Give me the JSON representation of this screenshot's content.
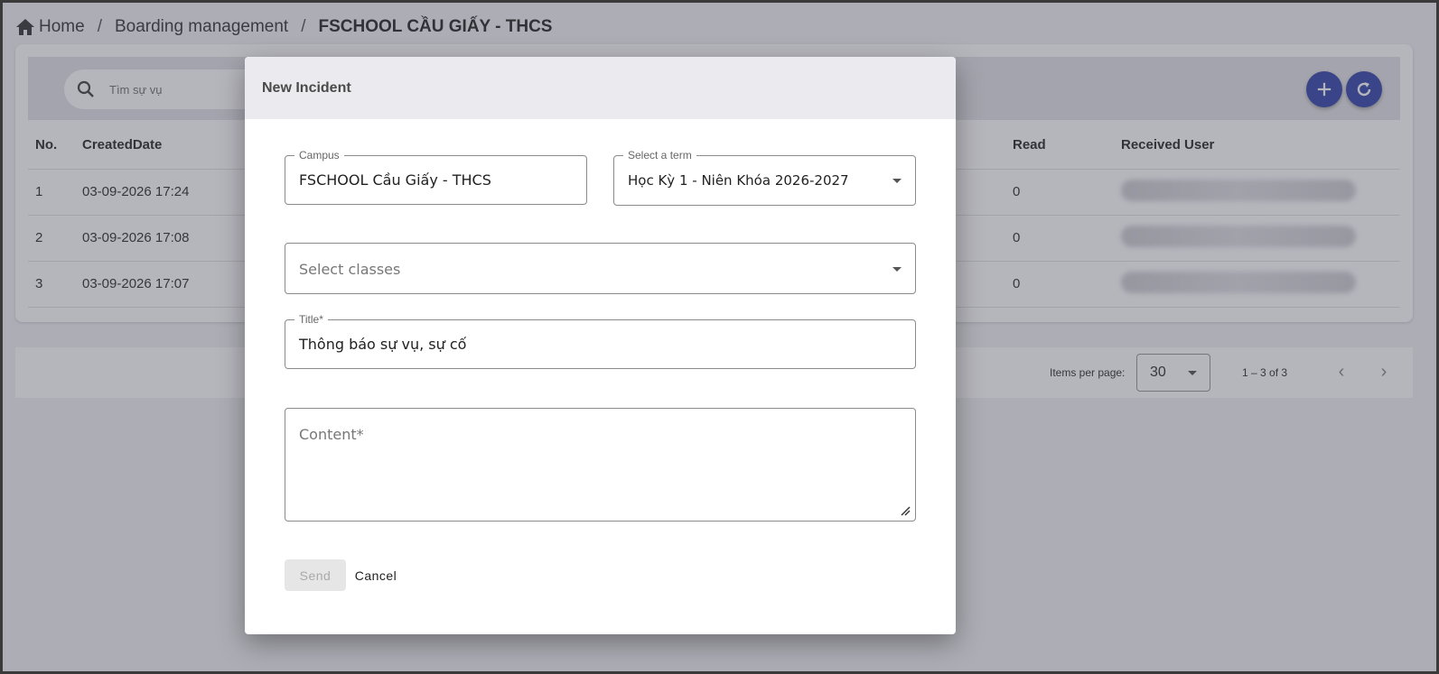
{
  "breadcrumb": {
    "home": "Home",
    "section": "Boarding management",
    "current": "FSCHOOL CẦU GIẤY - THCS"
  },
  "toolbar": {
    "search_placeholder": "Tìm sự vụ",
    "add_icon": "plus-icon",
    "refresh_icon": "refresh-icon"
  },
  "table": {
    "headers": {
      "no": "No.",
      "created": "CreatedDate",
      "read": "Read",
      "received": "Received User"
    },
    "rows": [
      {
        "no": "1",
        "created": "03-09-2026 17:24",
        "read": "0"
      },
      {
        "no": "2",
        "created": "03-09-2026 17:08",
        "read": "0"
      },
      {
        "no": "3",
        "created": "03-09-2026 17:07",
        "read": "0"
      }
    ]
  },
  "paginator": {
    "label": "Items per page:",
    "page_size": "30",
    "range": "1 – 3 of 3"
  },
  "dialog": {
    "title": "New Incident",
    "campus_label": "Campus",
    "campus_value": "FSCHOOL Cầu Giấy - THCS",
    "term_label": "Select a term",
    "term_value": "Học Kỳ 1 - Niên Khóa 2026-2027",
    "classes_placeholder": "Select classes",
    "title_label": "Title*",
    "title_value": "Thông báo sự vụ, sự cố",
    "content_placeholder": "Content*",
    "send_label": "Send",
    "cancel_label": "Cancel"
  },
  "colors": {
    "accent": "#3949ab",
    "backdrop": "#3c3c50"
  }
}
